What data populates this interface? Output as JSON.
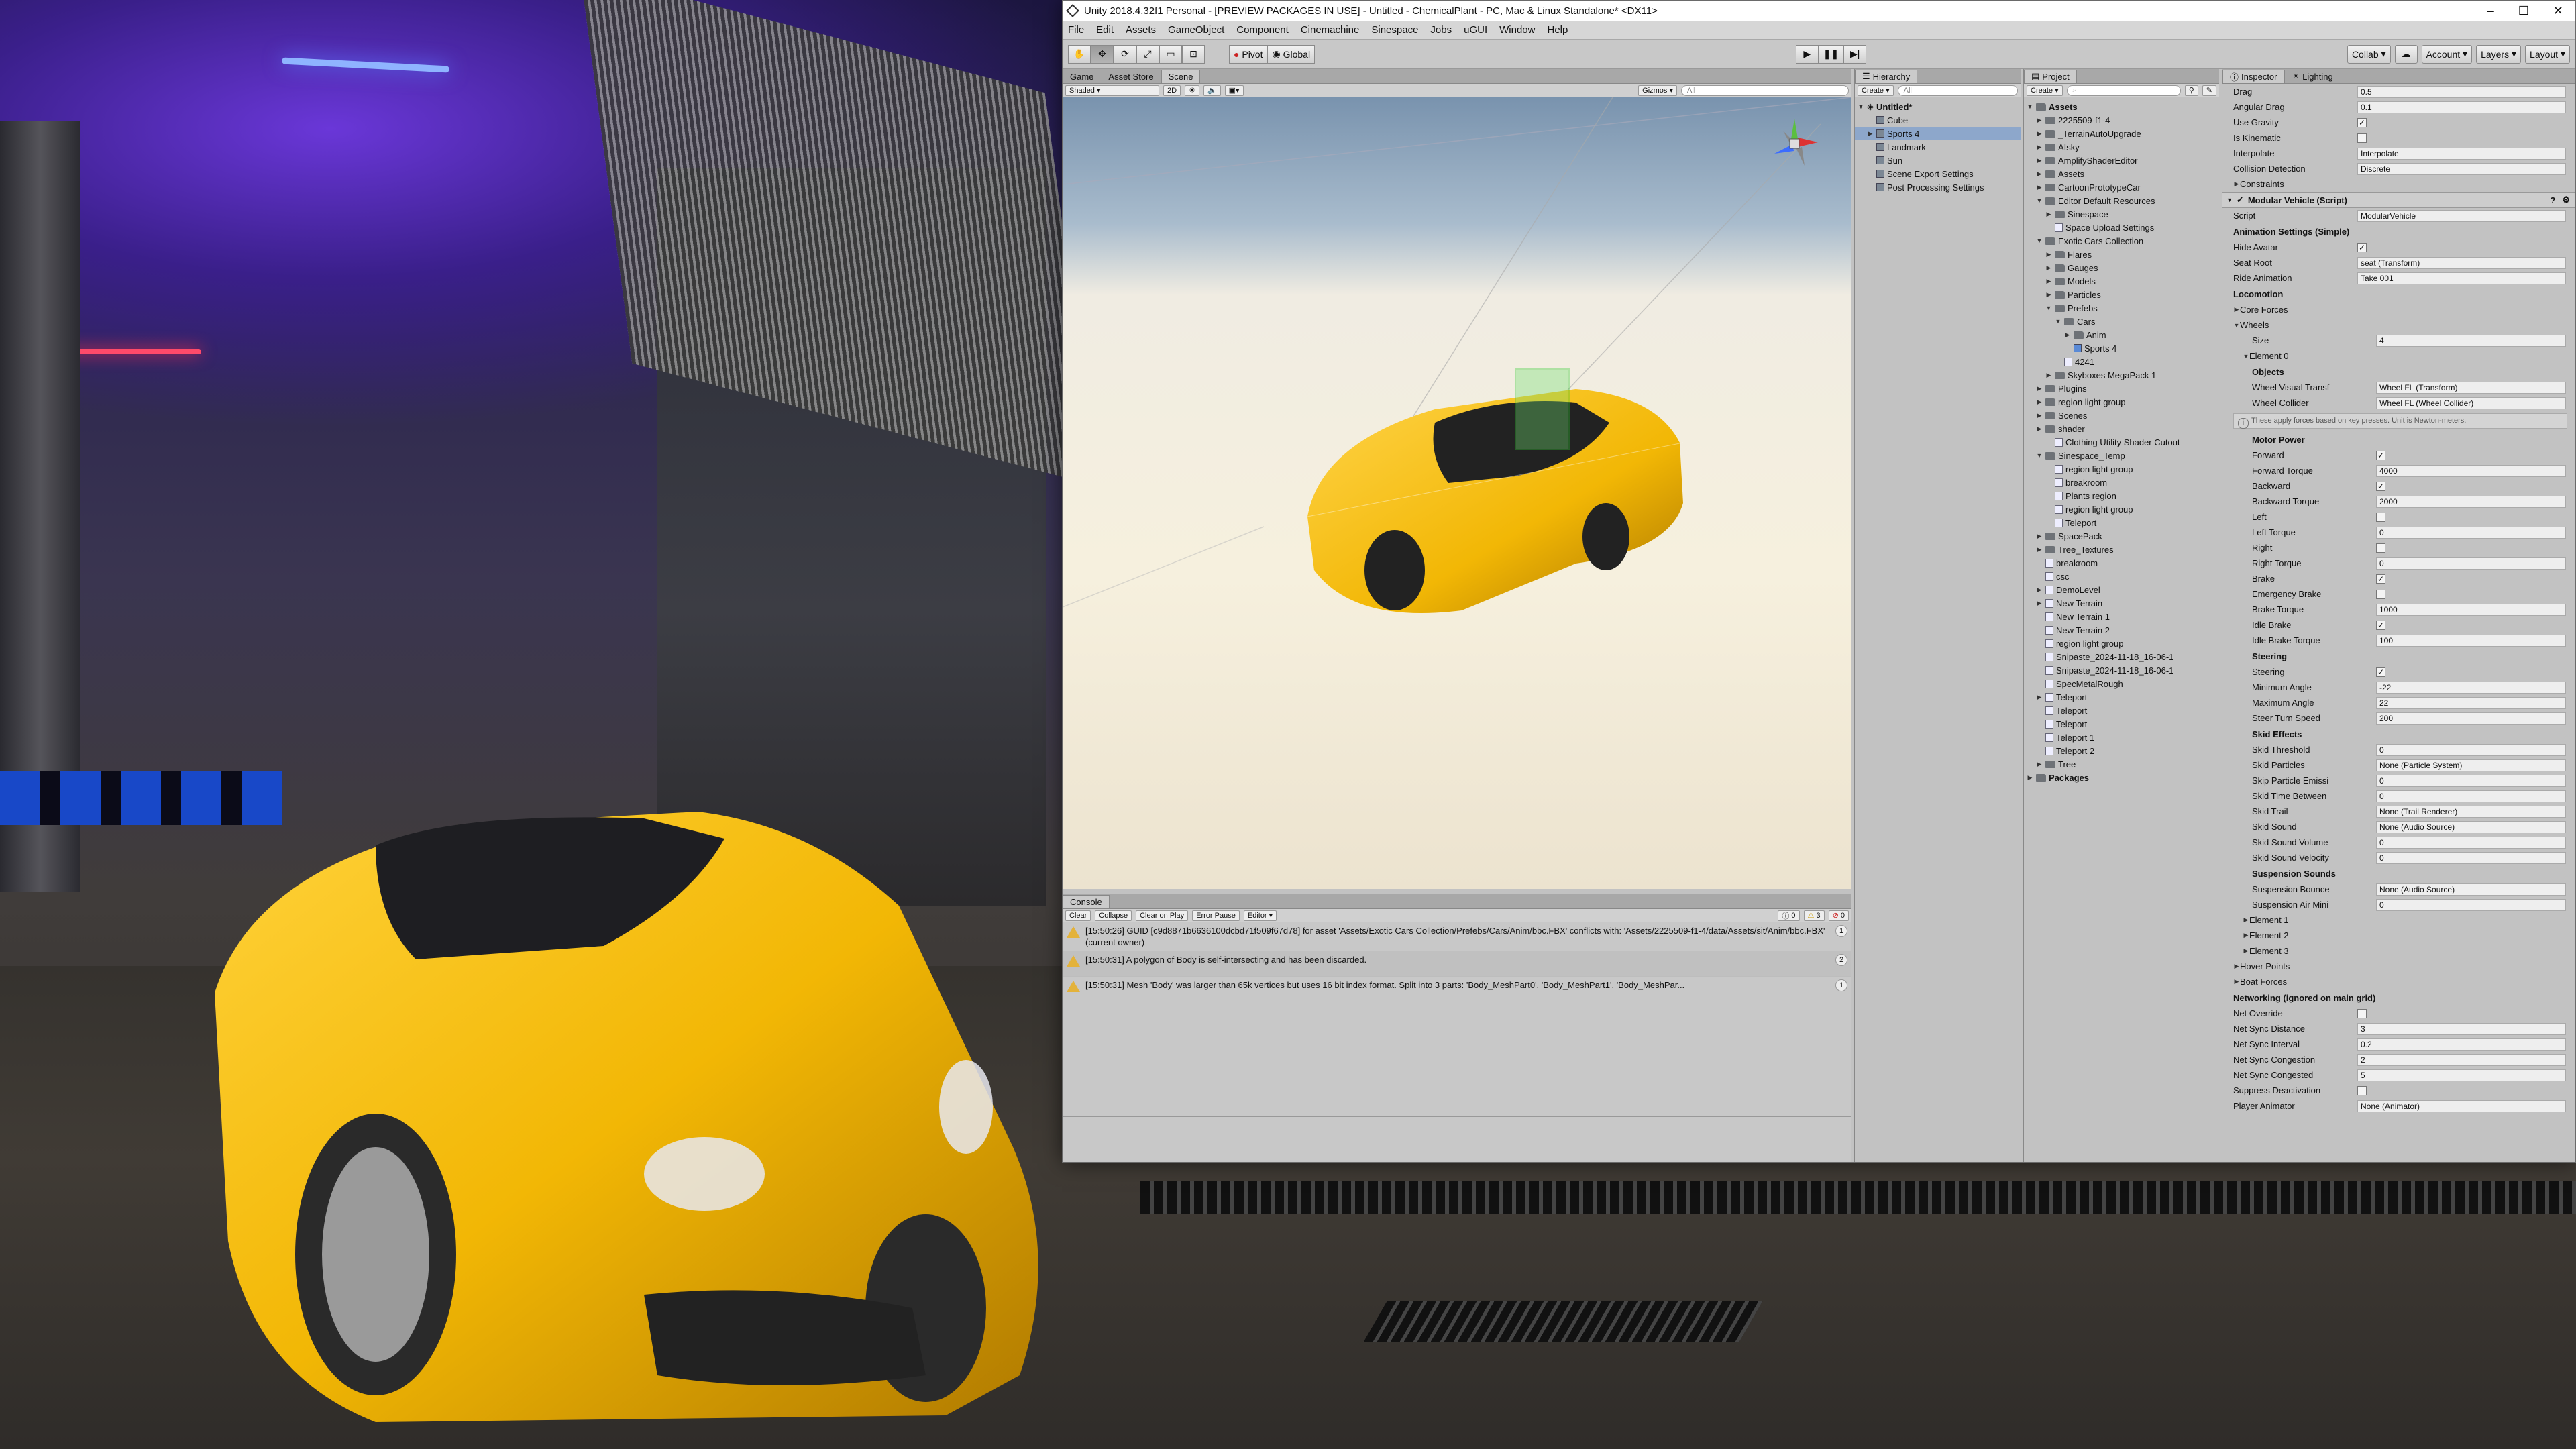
{
  "window": {
    "title": "Unity 2018.4.32f1 Personal - [PREVIEW PACKAGES IN USE] - Untitled - ChemicalPlant - PC, Mac & Linux Standalone* <DX11>"
  },
  "menu": [
    "File",
    "Edit",
    "Assets",
    "GameObject",
    "Component",
    "Cinemachine",
    "Sinespace",
    "Jobs",
    "uGUI",
    "Window",
    "Help"
  ],
  "toolbar": {
    "pivot": "Pivot",
    "global": "Global",
    "collab": "Collab",
    "account": "Account",
    "layers": "Layers",
    "layout": "Layout"
  },
  "scene_tabs": [
    "Game",
    "Asset Store",
    "Scene"
  ],
  "scene_bar": {
    "shading": "Shaded",
    "mode2d": "2D",
    "gizmos": "Gizmos",
    "search": "All"
  },
  "console": {
    "tab": "Console",
    "buttons": [
      "Clear",
      "Collapse",
      "Clear on Play",
      "Error Pause",
      "Editor"
    ],
    "counts": {
      "info": "0",
      "warn": "3",
      "error": "0"
    },
    "logs": [
      {
        "text": "[15:50:26] GUID [c9d8871b6636100dcbd71f509f67d78] for asset 'Assets/Exotic Cars Collection/Prefebs/Cars/Anim/bbc.FBX' conflicts with: 'Assets/2225509-f1-4/data/Assets/sit/Anim/bbc.FBX' (current owner)",
        "count": "1"
      },
      {
        "text": "[15:50:31] A polygon of Body is self-intersecting and has been discarded.",
        "count": "2"
      },
      {
        "text": "[15:50:31] Mesh 'Body' was larger than 65k vertices but uses 16 bit index format. Split into 3 parts: 'Body_MeshPart0', 'Body_MeshPart1', 'Body_MeshPar...",
        "count": "1"
      }
    ]
  },
  "hierarchy": {
    "tab": "Hierarchy",
    "create": "Create",
    "search": "All",
    "items": [
      {
        "label": "Untitled*",
        "depth": 0,
        "arrow": "▼",
        "bold": true
      },
      {
        "label": "Cube",
        "depth": 1,
        "arrow": ""
      },
      {
        "label": "Sports 4",
        "depth": 1,
        "arrow": "▶",
        "selected": true
      },
      {
        "label": "Landmark",
        "depth": 1,
        "arrow": ""
      },
      {
        "label": "Sun",
        "depth": 1,
        "arrow": ""
      },
      {
        "label": "Scene Export Settings",
        "depth": 1,
        "arrow": ""
      },
      {
        "label": "Post Processing Settings",
        "depth": 1,
        "arrow": ""
      }
    ]
  },
  "project": {
    "tab": "Project",
    "create": "Create",
    "items": [
      {
        "label": "Assets",
        "depth": 0,
        "arrow": "▼",
        "icon": "folder",
        "bold": true
      },
      {
        "label": "2225509-f1-4",
        "depth": 1,
        "arrow": "▶",
        "icon": "folder"
      },
      {
        "label": "_TerrainAutoUpgrade",
        "depth": 1,
        "arrow": "▶",
        "icon": "folder"
      },
      {
        "label": "AIsky",
        "depth": 1,
        "arrow": "▶",
        "icon": "folder"
      },
      {
        "label": "AmplifyShaderEditor",
        "depth": 1,
        "arrow": "▶",
        "icon": "folder"
      },
      {
        "label": "Assets",
        "depth": 1,
        "arrow": "▶",
        "icon": "folder"
      },
      {
        "label": "CartoonPrototypeCar",
        "depth": 1,
        "arrow": "▶",
        "icon": "folder"
      },
      {
        "label": "Editor Default Resources",
        "depth": 1,
        "arrow": "▼",
        "icon": "folder"
      },
      {
        "label": "Sinespace",
        "depth": 2,
        "arrow": "▶",
        "icon": "folder"
      },
      {
        "label": "Space Upload Settings",
        "depth": 2,
        "arrow": "",
        "icon": "file"
      },
      {
        "label": "Exotic Cars Collection",
        "depth": 1,
        "arrow": "▼",
        "icon": "folder"
      },
      {
        "label": "Flares",
        "depth": 2,
        "arrow": "▶",
        "icon": "folder"
      },
      {
        "label": "Gauges",
        "depth": 2,
        "arrow": "▶",
        "icon": "folder"
      },
      {
        "label": "Models",
        "depth": 2,
        "arrow": "▶",
        "icon": "folder"
      },
      {
        "label": "Particles",
        "depth": 2,
        "arrow": "▶",
        "icon": "folder"
      },
      {
        "label": "Prefebs",
        "depth": 2,
        "arrow": "▼",
        "icon": "folder"
      },
      {
        "label": "Cars",
        "depth": 3,
        "arrow": "▼",
        "icon": "folder"
      },
      {
        "label": "Anim",
        "depth": 4,
        "arrow": "▶",
        "icon": "folder"
      },
      {
        "label": "Sports 4",
        "depth": 4,
        "arrow": "",
        "icon": "cube"
      },
      {
        "label": "4241",
        "depth": 3,
        "arrow": "",
        "icon": "file"
      },
      {
        "label": "Skyboxes MegaPack 1",
        "depth": 2,
        "arrow": "▶",
        "icon": "folder"
      },
      {
        "label": "Plugins",
        "depth": 1,
        "arrow": "▶",
        "icon": "folder"
      },
      {
        "label": "region light group",
        "depth": 1,
        "arrow": "▶",
        "icon": "folder"
      },
      {
        "label": "Scenes",
        "depth": 1,
        "arrow": "▶",
        "icon": "folder"
      },
      {
        "label": "shader",
        "depth": 1,
        "arrow": "▶",
        "icon": "folder"
      },
      {
        "label": "Clothing Utility Shader Cutout",
        "depth": 2,
        "arrow": "",
        "icon": "file"
      },
      {
        "label": "Sinespace_Temp",
        "depth": 1,
        "arrow": "▼",
        "icon": "folder"
      },
      {
        "label": "region light group",
        "depth": 2,
        "arrow": "",
        "icon": "file"
      },
      {
        "label": "breakroom",
        "depth": 2,
        "arrow": "",
        "icon": "file"
      },
      {
        "label": "Plants region",
        "depth": 2,
        "arrow": "",
        "icon": "file"
      },
      {
        "label": "region light group",
        "depth": 2,
        "arrow": "",
        "icon": "file"
      },
      {
        "label": "Teleport",
        "depth": 2,
        "arrow": "",
        "icon": "file"
      },
      {
        "label": "SpacePack",
        "depth": 1,
        "arrow": "▶",
        "icon": "folder"
      },
      {
        "label": "Tree_Textures",
        "depth": 1,
        "arrow": "▶",
        "icon": "folder"
      },
      {
        "label": "breakroom",
        "depth": 1,
        "arrow": "",
        "icon": "file"
      },
      {
        "label": "csc",
        "depth": 1,
        "arrow": "",
        "icon": "file"
      },
      {
        "label": "DemoLevel",
        "depth": 1,
        "arrow": "▶",
        "icon": "file"
      },
      {
        "label": "New Terrain",
        "depth": 1,
        "arrow": "▶",
        "icon": "file"
      },
      {
        "label": "New Terrain 1",
        "depth": 1,
        "arrow": "",
        "icon": "file"
      },
      {
        "label": "New Terrain 2",
        "depth": 1,
        "arrow": "",
        "icon": "file"
      },
      {
        "label": "region light group",
        "depth": 1,
        "arrow": "",
        "icon": "file"
      },
      {
        "label": "Snipaste_2024-11-18_16-06-1",
        "depth": 1,
        "arrow": "",
        "icon": "file"
      },
      {
        "label": "Snipaste_2024-11-18_16-06-1",
        "depth": 1,
        "arrow": "",
        "icon": "file"
      },
      {
        "label": "SpecMetalRough",
        "depth": 1,
        "arrow": "",
        "icon": "file"
      },
      {
        "label": "Teleport",
        "depth": 1,
        "arrow": "▶",
        "icon": "file"
      },
      {
        "label": "Teleport",
        "depth": 1,
        "arrow": "",
        "icon": "file"
      },
      {
        "label": "Teleport",
        "depth": 1,
        "arrow": "",
        "icon": "file"
      },
      {
        "label": "Teleport 1",
        "depth": 1,
        "arrow": "",
        "icon": "file"
      },
      {
        "label": "Teleport 2",
        "depth": 1,
        "arrow": "",
        "icon": "file"
      },
      {
        "label": "Tree",
        "depth": 1,
        "arrow": "▶",
        "icon": "folder"
      },
      {
        "label": "Packages",
        "depth": 0,
        "arrow": "▶",
        "icon": "folder",
        "bold": true
      }
    ]
  },
  "inspector": {
    "tabs": [
      "Inspector",
      "Lighting"
    ],
    "rows": [
      {
        "kind": "field",
        "label": "Drag",
        "value": "0.5"
      },
      {
        "kind": "field",
        "label": "Angular Drag",
        "value": "0.1"
      },
      {
        "kind": "check",
        "label": "Use Gravity",
        "checked": true
      },
      {
        "kind": "check",
        "label": "Is Kinematic",
        "checked": false
      },
      {
        "kind": "field",
        "label": "Interpolate",
        "value": "Interpolate"
      },
      {
        "kind": "field",
        "label": "Collision Detection",
        "value": "Discrete"
      },
      {
        "kind": "fold",
        "label": "Constraints"
      },
      {
        "kind": "component",
        "label": "Modular Vehicle (Script)"
      },
      {
        "kind": "field",
        "label": "Script",
        "value": "ModularVehicle"
      },
      {
        "kind": "header",
        "label": "Animation Settings (Simple)"
      },
      {
        "kind": "check",
        "label": "Hide Avatar",
        "checked": true
      },
      {
        "kind": "field",
        "label": "Seat Root",
        "value": "seat (Transform)"
      },
      {
        "kind": "field",
        "label": "Ride Animation",
        "value": "Take 001"
      },
      {
        "kind": "header",
        "label": "Locomotion"
      },
      {
        "kind": "fold",
        "label": "Core Forces"
      },
      {
        "kind": "fold",
        "label": "Wheels",
        "open": true
      },
      {
        "kind": "field",
        "label": "Size",
        "value": "4",
        "indent": 2
      },
      {
        "kind": "fold",
        "label": "Element 0",
        "open": true,
        "indent": 1
      },
      {
        "kind": "header",
        "label": "Objects",
        "indent": 2
      },
      {
        "kind": "field",
        "label": "Wheel Visual Transf",
        "value": "Wheel FL (Transform)",
        "indent": 2
      },
      {
        "kind": "field",
        "label": "Wheel Collider",
        "value": "Wheel FL (Wheel Collider)",
        "indent": 2
      },
      {
        "kind": "note",
        "label": "These apply forces based on key presses. Unit is Newton-meters."
      },
      {
        "kind": "header",
        "label": "Motor Power",
        "indent": 2
      },
      {
        "kind": "check",
        "label": "Forward",
        "checked": true,
        "indent": 2
      },
      {
        "kind": "field",
        "label": "Forward Torque",
        "value": "4000",
        "indent": 2
      },
      {
        "kind": "check",
        "label": "Backward",
        "checked": true,
        "indent": 2
      },
      {
        "kind": "field",
        "label": "Backward Torque",
        "value": "2000",
        "indent": 2
      },
      {
        "kind": "check",
        "label": "Left",
        "checked": false,
        "indent": 2
      },
      {
        "kind": "field",
        "label": "Left Torque",
        "value": "0",
        "indent": 2
      },
      {
        "kind": "check",
        "label": "Right",
        "checked": false,
        "indent": 2
      },
      {
        "kind": "field",
        "label": "Right Torque",
        "value": "0",
        "indent": 2
      },
      {
        "kind": "check",
        "label": "Brake",
        "checked": true,
        "indent": 2
      },
      {
        "kind": "check",
        "label": "Emergency Brake",
        "checked": false,
        "indent": 2
      },
      {
        "kind": "field",
        "label": "Brake Torque",
        "value": "1000",
        "indent": 2
      },
      {
        "kind": "check",
        "label": "Idle Brake",
        "checked": true,
        "indent": 2
      },
      {
        "kind": "field",
        "label": "Idle Brake Torque",
        "value": "100",
        "indent": 2
      },
      {
        "kind": "header",
        "label": "Steering",
        "indent": 2
      },
      {
        "kind": "check",
        "label": "Steering",
        "checked": true,
        "indent": 2
      },
      {
        "kind": "field",
        "label": "Minimum Angle",
        "value": "-22",
        "indent": 2
      },
      {
        "kind": "field",
        "label": "Maximum Angle",
        "value": "22",
        "indent": 2
      },
      {
        "kind": "field",
        "label": "Steer Turn Speed",
        "value": "200",
        "indent": 2
      },
      {
        "kind": "header",
        "label": "Skid Effects",
        "indent": 2
      },
      {
        "kind": "field",
        "label": "Skid Threshold",
        "value": "0",
        "indent": 2
      },
      {
        "kind": "field",
        "label": "Skid Particles",
        "value": "None (Particle System)",
        "indent": 2
      },
      {
        "kind": "field",
        "label": "Skip Particle Emissi",
        "value": "0",
        "indent": 2
      },
      {
        "kind": "field",
        "label": "Skid Time Between",
        "value": "0",
        "indent": 2
      },
      {
        "kind": "field",
        "label": "Skid Trail",
        "value": "None (Trail Renderer)",
        "indent": 2
      },
      {
        "kind": "field",
        "label": "Skid Sound",
        "value": "None (Audio Source)",
        "indent": 2
      },
      {
        "kind": "field",
        "label": "Skid Sound Volume",
        "value": "0",
        "indent": 2
      },
      {
        "kind": "field",
        "label": "Skid Sound Velocity",
        "value": "0",
        "indent": 2
      },
      {
        "kind": "header",
        "label": "Suspension Sounds",
        "indent": 2
      },
      {
        "kind": "field",
        "label": "Suspension Bounce",
        "value": "None (Audio Source)",
        "indent": 2
      },
      {
        "kind": "field",
        "label": "Suspension Air Mini",
        "value": "0",
        "indent": 2
      },
      {
        "kind": "fold",
        "label": "Element 1",
        "indent": 1
      },
      {
        "kind": "fold",
        "label": "Element 2",
        "indent": 1
      },
      {
        "kind": "fold",
        "label": "Element 3",
        "indent": 1
      },
      {
        "kind": "fold",
        "label": "Hover Points"
      },
      {
        "kind": "fold",
        "label": "Boat Forces"
      },
      {
        "kind": "header",
        "label": "Networking (ignored on main grid)"
      },
      {
        "kind": "check",
        "label": "Net Override",
        "checked": false
      },
      {
        "kind": "field",
        "label": "Net Sync Distance",
        "value": "3"
      },
      {
        "kind": "field",
        "label": "Net Sync Interval",
        "value": "0.2"
      },
      {
        "kind": "field",
        "label": "Net Sync Congestion",
        "value": "2"
      },
      {
        "kind": "field",
        "label": "Net Sync Congested",
        "value": "5"
      },
      {
        "kind": "check",
        "label": "Suppress Deactivation",
        "checked": false
      },
      {
        "kind": "field",
        "label": "Player Animator",
        "value": "None (Animator)"
      }
    ]
  },
  "colors": {
    "car_yellow": "#f2b705",
    "selection": "#8da7cb",
    "neon_blue": "#3b6cff",
    "neon_red": "#ff2f4a"
  }
}
